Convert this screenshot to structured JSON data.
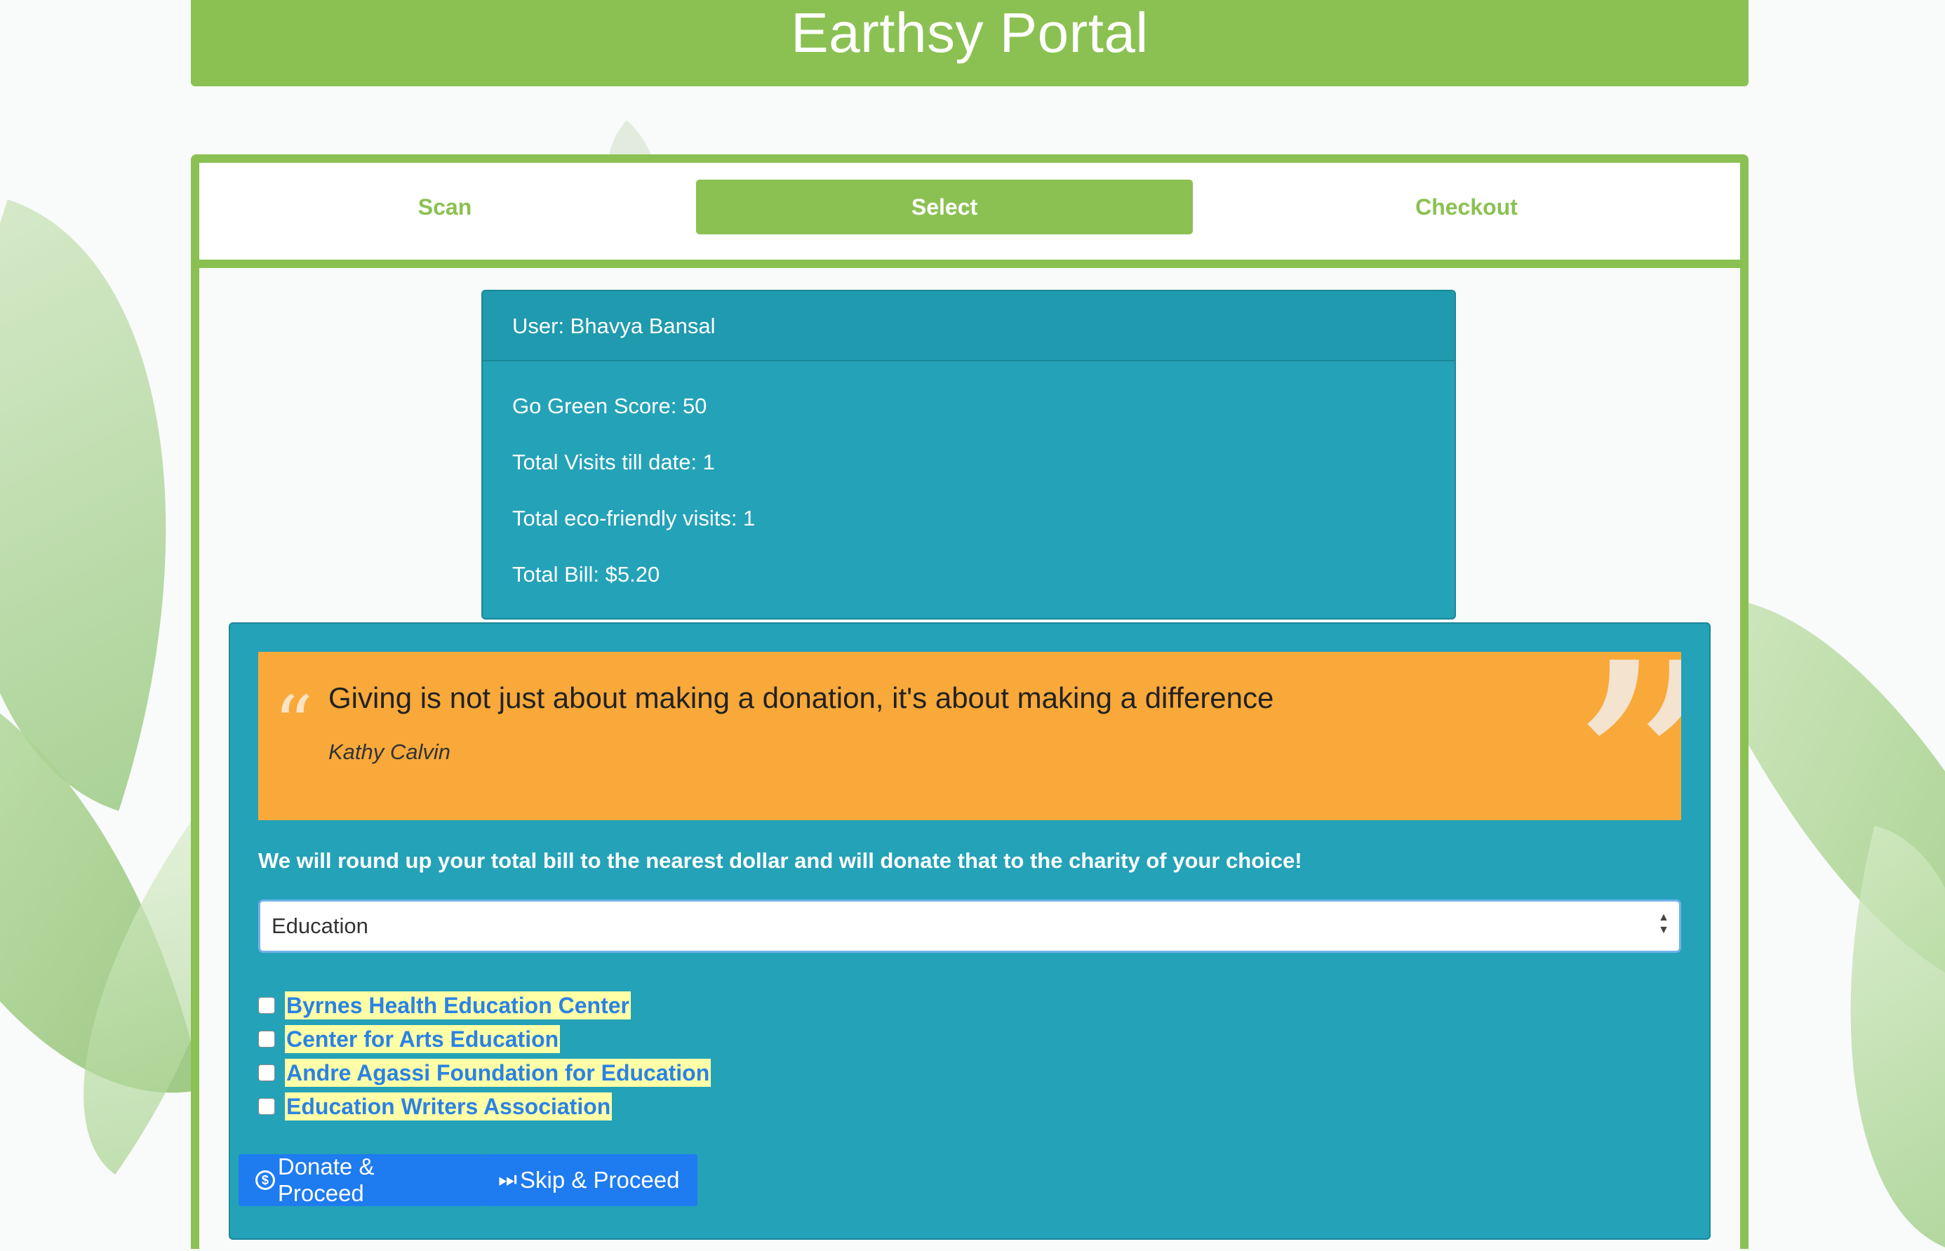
{
  "header": {
    "title": "Earthsy Portal"
  },
  "tabs": [
    {
      "label": "Scan",
      "active": false
    },
    {
      "label": "Select",
      "active": true
    },
    {
      "label": "Checkout",
      "active": false
    }
  ],
  "user_card": {
    "user": "User: Bhavya Bansal",
    "go_green_score": "Go Green Score: 50",
    "total_visits": "Total Visits till date: 1",
    "eco_visits": "Total eco-friendly visits: 1",
    "total_bill": "Total Bill: $5.20"
  },
  "quote": {
    "text": "Giving is not just about making a donation, it's about making a difference",
    "author": "Kathy Calvin"
  },
  "donation": {
    "message": "We will round up your total bill to the nearest dollar and will donate that to the charity of your choice!",
    "category_selected": "Education",
    "charities": [
      {
        "name": "Byrnes Health Education Center",
        "checked": false
      },
      {
        "name": "Center for Arts Education",
        "checked": false
      },
      {
        "name": "Andre Agassi Foundation for Education",
        "checked": false
      },
      {
        "name": "Education Writers Association",
        "checked": false
      }
    ]
  },
  "buttons": {
    "donate": "Donate & Proceed",
    "skip": "Skip & Proceed"
  },
  "colors": {
    "brand_green": "#8bc152",
    "panel_teal": "#24a2b8",
    "quote_orange": "#f8a93a",
    "button_blue": "#1e7bf0"
  },
  "icons": {
    "donate": "dollar-coin-icon",
    "skip": "fast-forward-icon"
  }
}
